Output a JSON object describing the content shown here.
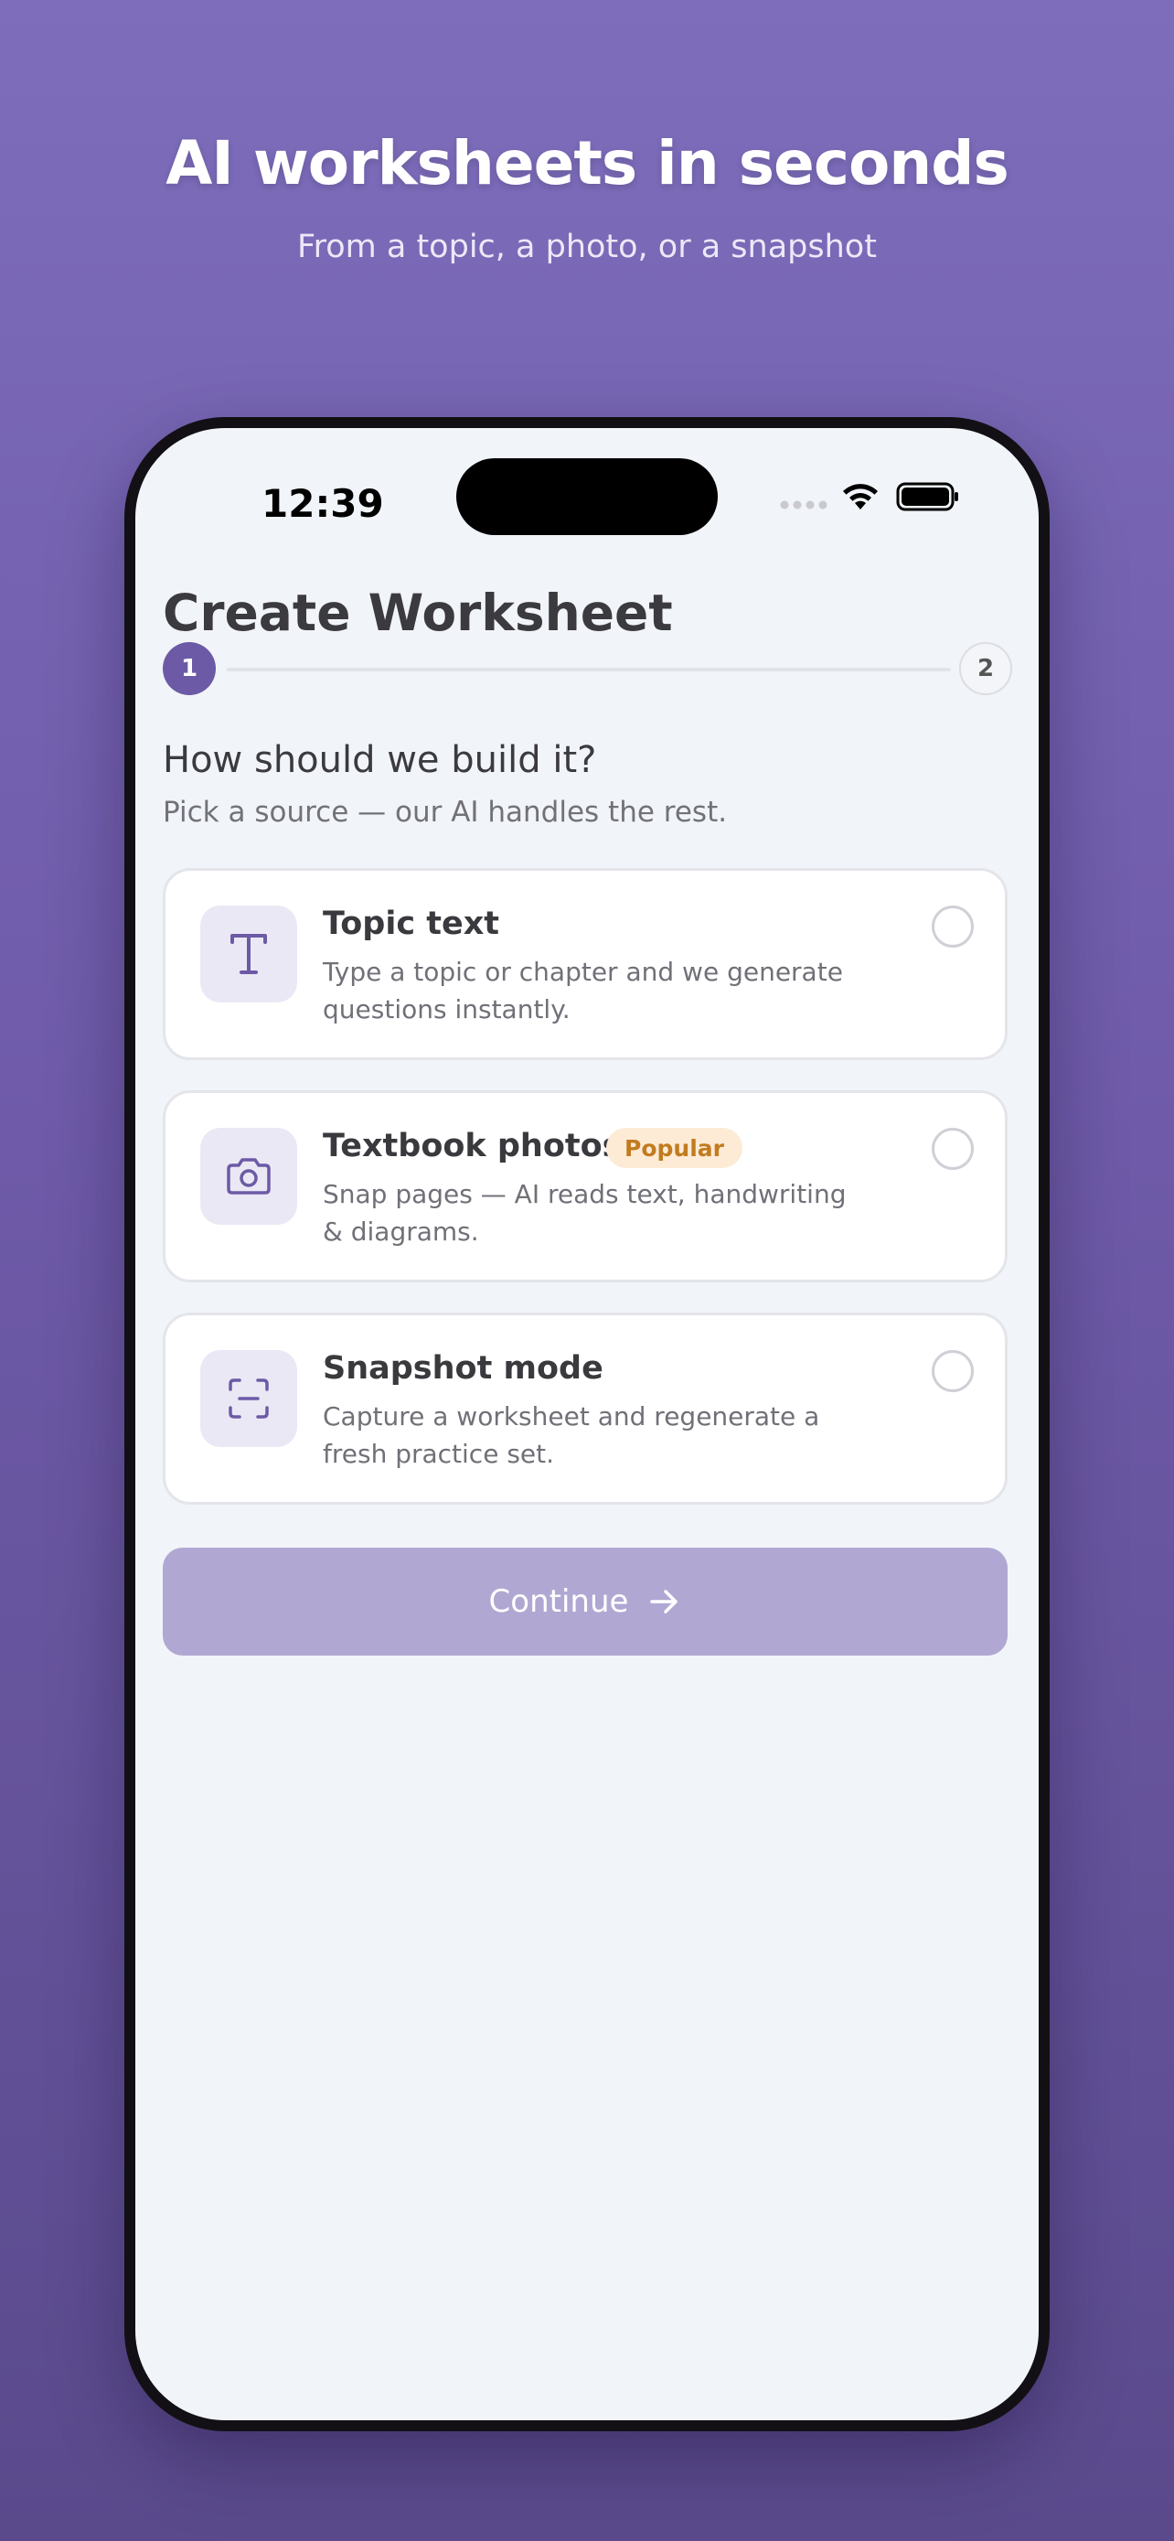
{
  "hero": {
    "title": "AI worksheets in seconds",
    "subtitle": "From a topic, a photo, or a snapshot"
  },
  "status_bar": {
    "time": "12:39",
    "icons": [
      "signal-icon",
      "wifi-icon",
      "battery-icon"
    ]
  },
  "header": {
    "title": "Create Worksheet"
  },
  "stepper": {
    "steps": [
      {
        "label": "1",
        "state": "active"
      },
      {
        "label": "2",
        "state": "inactive"
      }
    ]
  },
  "prompt": {
    "question": "How should we build it?",
    "subtitle": "Pick a source — our AI handles the rest."
  },
  "options": [
    {
      "title": "Topic text",
      "description": "Type a topic or chapter and we generate questions instantly.",
      "icon": "text-icon",
      "selected": false
    },
    {
      "title": "Textbook photos",
      "badge": "Popular",
      "description": "Snap pages — AI reads text, handwriting & diagrams.",
      "icon": "camera-icon",
      "selected": false
    },
    {
      "title": "Snapshot mode",
      "description": "Capture a worksheet and regenerate a fresh practice set.",
      "icon": "scan-icon",
      "selected": false
    }
  ],
  "continue_button": {
    "label": "Continue",
    "icon": "arrow-right-icon",
    "enabled": false
  },
  "colors": {
    "accent": "#6c5aa6",
    "background_top": "#7d6dbb",
    "background_bottom": "#5a4a8c",
    "screen_bg": "#f1f4f9",
    "button_disabled": "#b0a8d3",
    "badge_bg": "#fdebd6",
    "badge_text": "#c27b1f"
  }
}
